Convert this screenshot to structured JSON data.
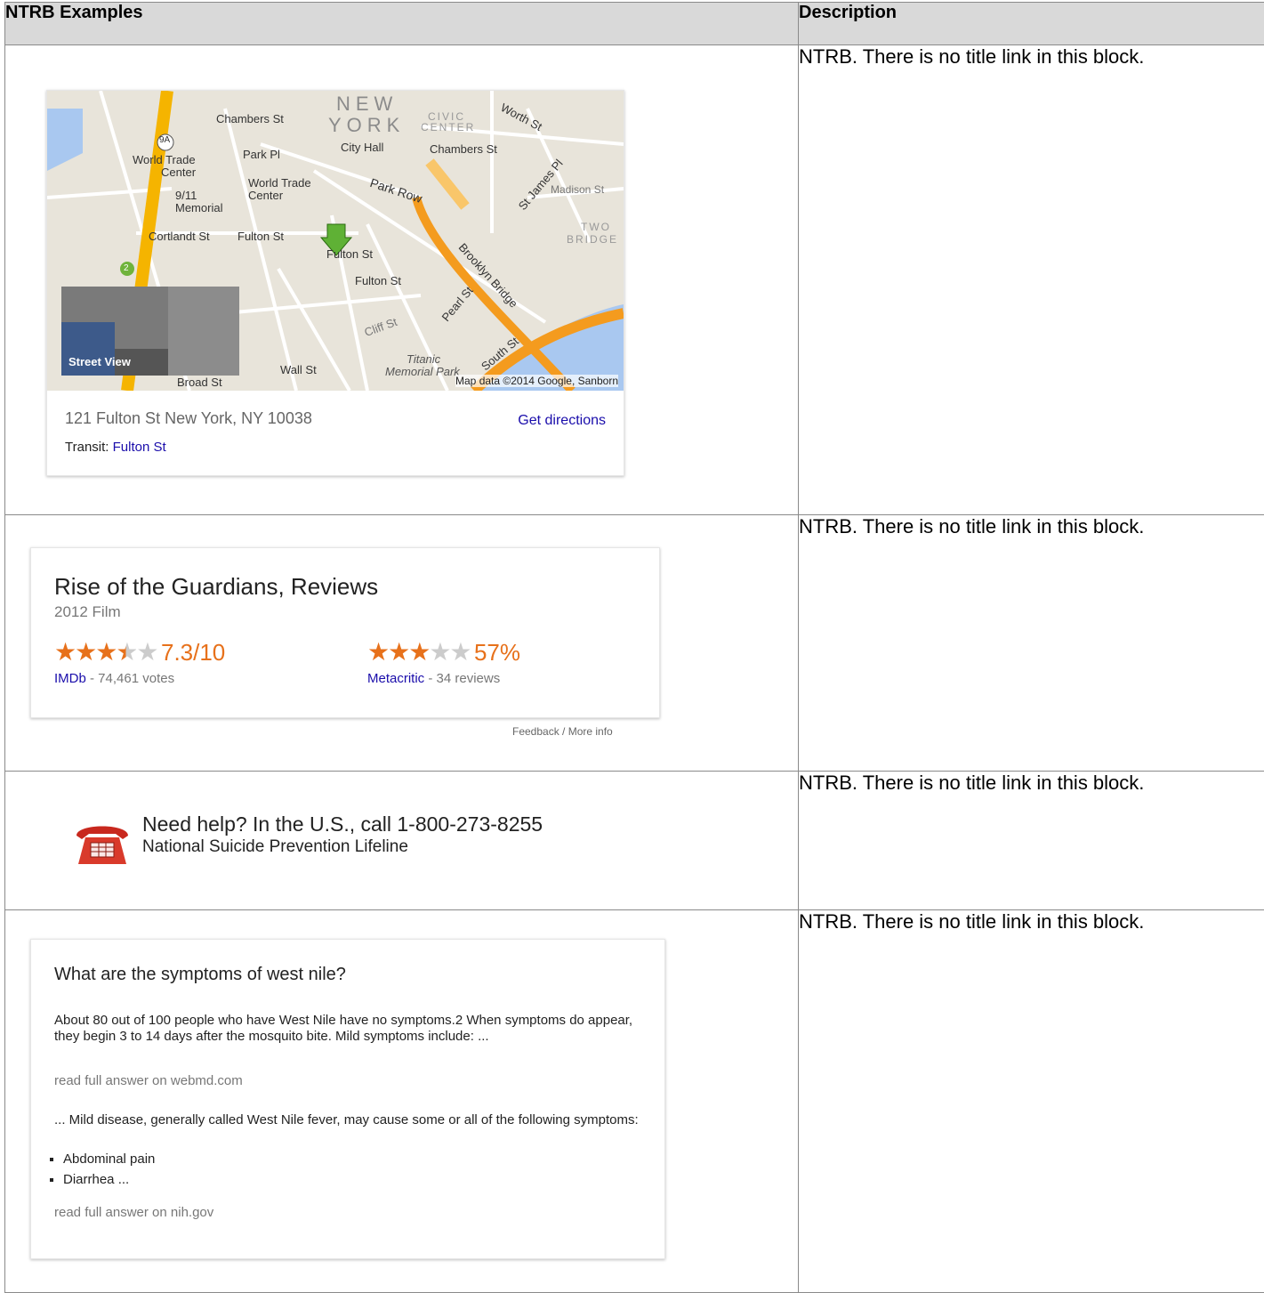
{
  "header": {
    "col1": "NTRB Examples",
    "col2": "Description"
  },
  "desc": [
    "NTRB.  There is no title link in this block.",
    "NTRB.  There is no title link in this block.",
    "NTRB.  There is no title link in this block.",
    "NTRB.  There is no title link in this block."
  ],
  "map": {
    "labels": {
      "new": "NEW",
      "york": "YORK",
      "civic": "CIVIC",
      "center": "CENTER",
      "chambers1": "Chambers St",
      "chambers2": "Chambers St",
      "worth": "Worth St",
      "cityhall": "City Hall",
      "parkpl": "Park Pl",
      "wtc1": "World Trade",
      "wtc2": "Center",
      "wtc3": "World Trade",
      "wtc4": "Center",
      "memorial1": "9/11",
      "memorial2": "Memorial",
      "parkrow": "Park Row",
      "stjames": "St James Pl",
      "madison": "Madison St",
      "cortlandt": "Cortlandt St",
      "fulton1": "Fulton St",
      "fulton2": "Fulton St",
      "fulton3": "Fulton St",
      "twobridge": "TWO",
      "bridge": "BRIDGE",
      "brooklyn": "Brooklyn Bridge",
      "pearl": "Pearl St",
      "cliff": "Cliff St",
      "titanic1": "Titanic",
      "titanic2": "Memorial Park",
      "southst": "South St",
      "wall": "Wall St",
      "broad": "Broad St",
      "nine_a": "9A",
      "two": "2"
    },
    "street_view": "Street View",
    "attribution": "Map data ©2014 Google, Sanborn",
    "address": "121 Fulton St New York, NY 10038",
    "directions": "Get directions",
    "transit_label": "Transit:",
    "transit_link": "Fulton St"
  },
  "movie": {
    "title": "Rise of the Guardians, Reviews",
    "subtitle": "2012 Film",
    "imdb": {
      "rating": "7.3/10",
      "stars": 3.5,
      "source": "IMDb",
      "count": " - 74,461 votes"
    },
    "meta": {
      "rating": "57%",
      "stars": 3,
      "source": "Metacritic",
      "count": " - 34 reviews"
    },
    "feedback": "Feedback / More info"
  },
  "help": {
    "line1": "Need help? In the U.S., call 1-800-273-8255",
    "line2": "National Suicide Prevention Lifeline"
  },
  "qa": {
    "question": "What are the symptoms of west nile?",
    "answer1": "About 80 out of 100 people who have West Nile have no symptoms.2 When symptoms do appear, they begin 3 to 14 days after the mosquito bite. Mild symptoms include: ...",
    "source1": "read full answer on webmd.com",
    "answer2": "... Mild disease, generally called West Nile fever, may cause some or all of the following symptoms:",
    "bullets": [
      "Abdominal pain",
      "Diarrhea ..."
    ],
    "source2": "read full answer on nih.gov"
  }
}
